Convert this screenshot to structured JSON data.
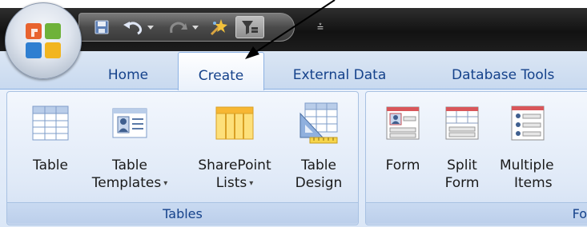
{
  "app": {
    "orb_icon": "office-logo"
  },
  "quick_access": {
    "save_icon": "save-icon",
    "undo_icon": "undo-icon",
    "redo_icon": "redo-icon",
    "wand_icon": "wand-icon",
    "filter_icon": "filter-toggle-icon",
    "customize_glyph": "⩮"
  },
  "tabs": [
    {
      "label": "Home",
      "active": false
    },
    {
      "label": "Create",
      "active": true
    },
    {
      "label": "External Data",
      "active": false
    },
    {
      "label": "Database Tools",
      "active": false
    }
  ],
  "groups": {
    "tables": {
      "label": "Tables",
      "buttons": [
        {
          "line1": "Table",
          "line2": "",
          "icon": "table-icon"
        },
        {
          "line1": "Table",
          "line2": "Templates",
          "dropdown": "▾",
          "icon": "table-templates-icon"
        },
        {
          "line1": "SharePoint",
          "line2": "Lists",
          "dropdown": "▾",
          "icon": "sharepoint-lists-icon"
        },
        {
          "line1": "Table",
          "line2": "Design",
          "icon": "table-design-icon"
        }
      ]
    },
    "forms": {
      "label": "Fo",
      "buttons": [
        {
          "line1": "Form",
          "line2": "",
          "icon": "form-icon"
        },
        {
          "line1": "Split",
          "line2": "Form",
          "icon": "split-form-icon"
        },
        {
          "line1": "Multiple",
          "line2": "Items",
          "icon": "multiple-items-icon"
        }
      ]
    }
  },
  "colors": {
    "tab_text": "#15428b",
    "ribbon_border": "#8db2e3",
    "titlebar": "#1a1a1a"
  }
}
